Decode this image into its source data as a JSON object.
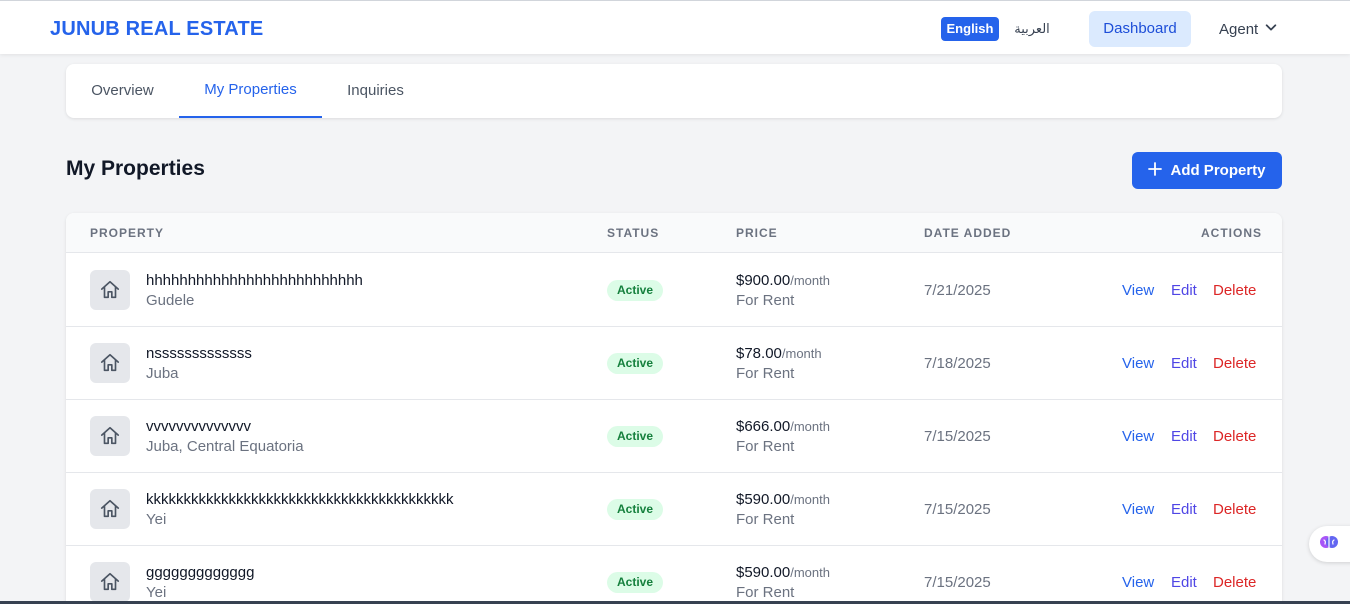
{
  "header": {
    "brand": "JUNUB REAL ESTATE",
    "lang_english": "English",
    "lang_arabic": "العربية",
    "dashboard_label": "Dashboard",
    "agent_label": "Agent",
    "accent_color": "#2563eb"
  },
  "tabs": [
    {
      "label": "Overview",
      "active": false
    },
    {
      "label": "My Properties",
      "active": true
    },
    {
      "label": "Inquiries",
      "active": false
    }
  ],
  "page": {
    "title": "My Properties",
    "add_button_label": "Add Property"
  },
  "table": {
    "columns": [
      "PROPERTY",
      "STATUS",
      "PRICE",
      "DATE ADDED",
      "ACTIONS"
    ],
    "rows": [
      {
        "name": "hhhhhhhhhhhhhhhhhhhhhhhhhh",
        "location": "Gudele",
        "status": "Active",
        "price": "$900.00",
        "period": "/month",
        "type": "For Rent",
        "date": "7/21/2025",
        "view": "View",
        "edit": "Edit",
        "delete": "Delete"
      },
      {
        "name": "nsssssssssssss",
        "location": "Juba",
        "status": "Active",
        "price": "$78.00",
        "period": "/month",
        "type": "For Rent",
        "date": "7/18/2025",
        "view": "View",
        "edit": "Edit",
        "delete": "Delete"
      },
      {
        "name": "vvvvvvvvvvvvvv",
        "location": "Juba, Central Equatoria",
        "status": "Active",
        "price": "$666.00",
        "period": "/month",
        "type": "For Rent",
        "date": "7/15/2025",
        "view": "View",
        "edit": "Edit",
        "delete": "Delete"
      },
      {
        "name": "kkkkkkkkkkkkkkkkkkkkkkkkkkkkkkkkkkkkkkkkk",
        "location": "Yei",
        "status": "Active",
        "price": "$590.00",
        "period": "/month",
        "type": "For Rent",
        "date": "7/15/2025",
        "view": "View",
        "edit": "Edit",
        "delete": "Delete"
      },
      {
        "name": "ggggggggggggg",
        "location": "Yei",
        "status": "Active",
        "price": "$590.00",
        "period": "/month",
        "type": "For Rent",
        "date": "7/15/2025",
        "view": "View",
        "edit": "Edit",
        "delete": "Delete"
      }
    ]
  },
  "icons": {
    "row_thumb": "home-icon",
    "add": "plus-icon",
    "agent_menu": "chevron-down-icon",
    "floating": "brain-icon"
  }
}
